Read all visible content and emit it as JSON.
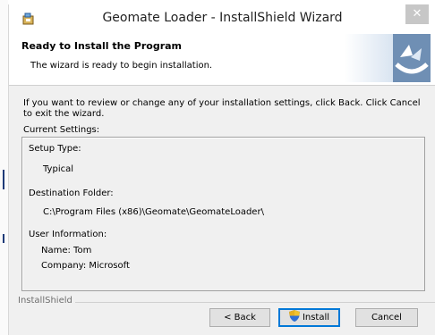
{
  "window": {
    "title": "Geomate Loader - InstallShield Wizard",
    "close_glyph": "✕"
  },
  "banner": {
    "title": "Ready to Install the Program",
    "subtitle": "The wizard is ready to begin installation."
  },
  "intro_text": "If you want to review or change any of your installation settings, click Back. Click Cancel to exit the wizard.",
  "current_settings_label": "Current Settings:",
  "settings": {
    "setup_type_label": "Setup Type:",
    "setup_type_value": "Typical",
    "destination_label": "Destination Folder:",
    "destination_value": "C:\\Program Files (x86)\\Geomate\\GeomateLoader\\",
    "user_info_label": "User Information:",
    "name_line": "Name: Tom",
    "company_line": "Company: Microsoft"
  },
  "footer_brand": "InstallShield",
  "buttons": {
    "back": "< Back",
    "install": "Install",
    "cancel": "Cancel"
  },
  "icons": {
    "title_icon": "installer-icon",
    "banner_logo": "installshield-logo",
    "install_shield": "uac-shield-icon"
  }
}
